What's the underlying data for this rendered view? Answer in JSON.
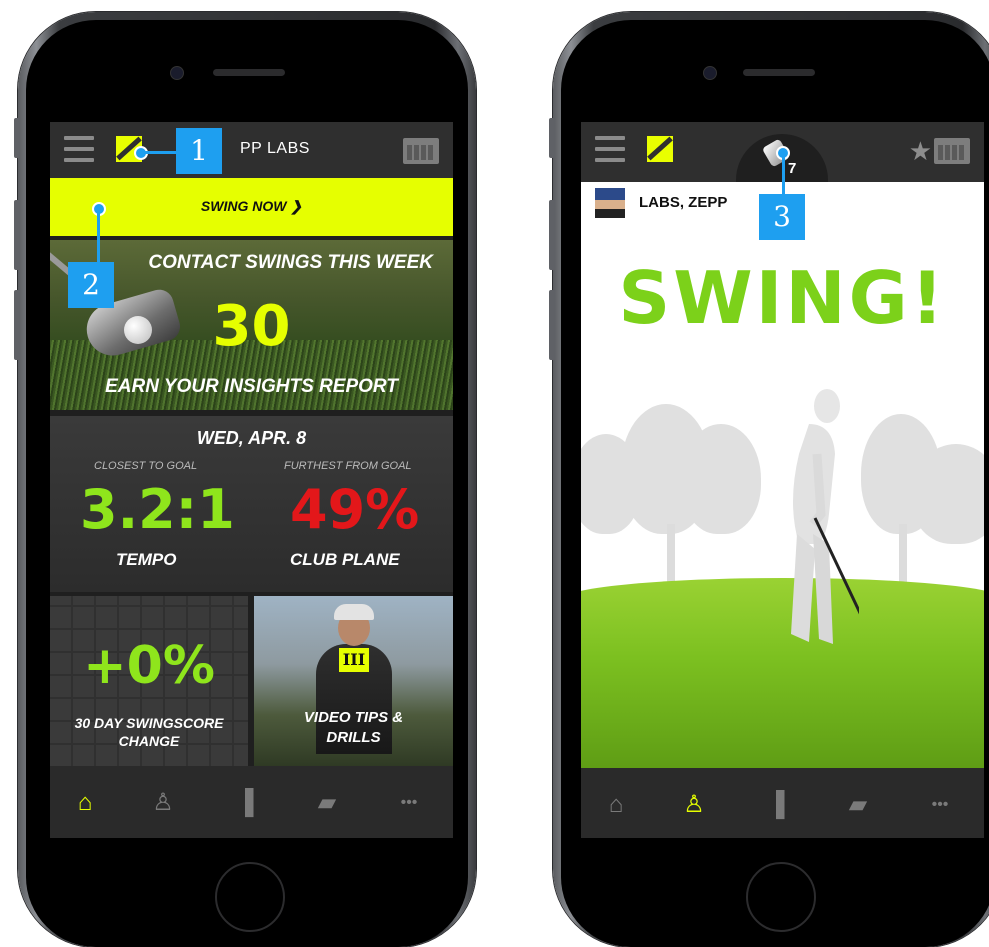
{
  "left": {
    "header": {
      "title": "PP LABS"
    },
    "swing_now": {
      "label": "SWING NOW ❯"
    },
    "banner": {
      "top_text": "CONTACT SWINGS THIS WEEK",
      "count": "30",
      "bottom_text": "EARN YOUR INSIGHTS REPORT"
    },
    "stats": {
      "date": "WED, APR. 8",
      "closest": {
        "label": "CLOSEST TO GOAL",
        "value": "3.2:1",
        "name": "TEMPO",
        "color": "#8fe51c"
      },
      "furthest": {
        "label": "FURTHEST FROM GOAL",
        "value": "49%",
        "name": "CLUB PLANE",
        "color": "#e3171a"
      }
    },
    "swingscore": {
      "value": "+0%",
      "caption_line1": "30 DAY SWINGSCORE",
      "caption_line2": "CHANGE"
    },
    "video": {
      "icon_text": "III",
      "caption_line1": "VIDEO TIPS &",
      "caption_line2": "DRILLS"
    },
    "tabs": [
      {
        "icon": "home-icon",
        "glyph": "⌂",
        "active": true
      },
      {
        "icon": "golfer-icon",
        "glyph": "♙",
        "active": false
      },
      {
        "icon": "bar-chart-icon",
        "glyph": "▐",
        "active": false
      },
      {
        "icon": "video-camera-icon",
        "glyph": "▰",
        "active": false
      },
      {
        "icon": "more-icon",
        "glyph": "•••",
        "active": false
      }
    ]
  },
  "right": {
    "club_number": "7",
    "profile_name": "LABS, ZEPP",
    "swing_title": "SWING!",
    "tabs": [
      {
        "icon": "home-icon",
        "glyph": "⌂",
        "active": false
      },
      {
        "icon": "golfer-icon",
        "glyph": "♙",
        "active": true
      },
      {
        "icon": "bar-chart-icon",
        "glyph": "▐",
        "active": false
      },
      {
        "icon": "video-camera-icon",
        "glyph": "▰",
        "active": false
      },
      {
        "icon": "more-icon",
        "glyph": "•••",
        "active": false
      }
    ]
  },
  "callouts": {
    "c1": "1",
    "c2": "2",
    "c3": "3"
  },
  "colors": {
    "accent": "#e6ff00",
    "green": "#7cd11a",
    "red": "#e3171a",
    "callout": "#1e9ff0"
  }
}
